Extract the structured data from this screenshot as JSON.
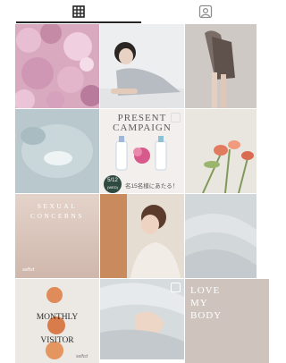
{
  "tabs": [
    {
      "id": "posts",
      "icon": "grid-icon",
      "active": true
    },
    {
      "id": "tagged",
      "icon": "tagged-person-icon",
      "active": false
    }
  ],
  "posts": {
    "present": {
      "title_line1": "PRESENT",
      "title_line2": "CAMPAIGN",
      "date": "5/12",
      "date_sub": "(WED)",
      "count_text": "名15名様にあたる！"
    },
    "sexual": {
      "line1": "SEXUAL",
      "line2": "CONCERNS"
    },
    "monthly": {
      "line1": "MONTHLY",
      "line2": "VISITOR"
    },
    "love": {
      "line1": "LOVE",
      "line2": "MY",
      "line3": "BODY"
    },
    "signature": "selfcd"
  },
  "colors": {
    "accent": "#262626",
    "background": "#ffffff"
  }
}
